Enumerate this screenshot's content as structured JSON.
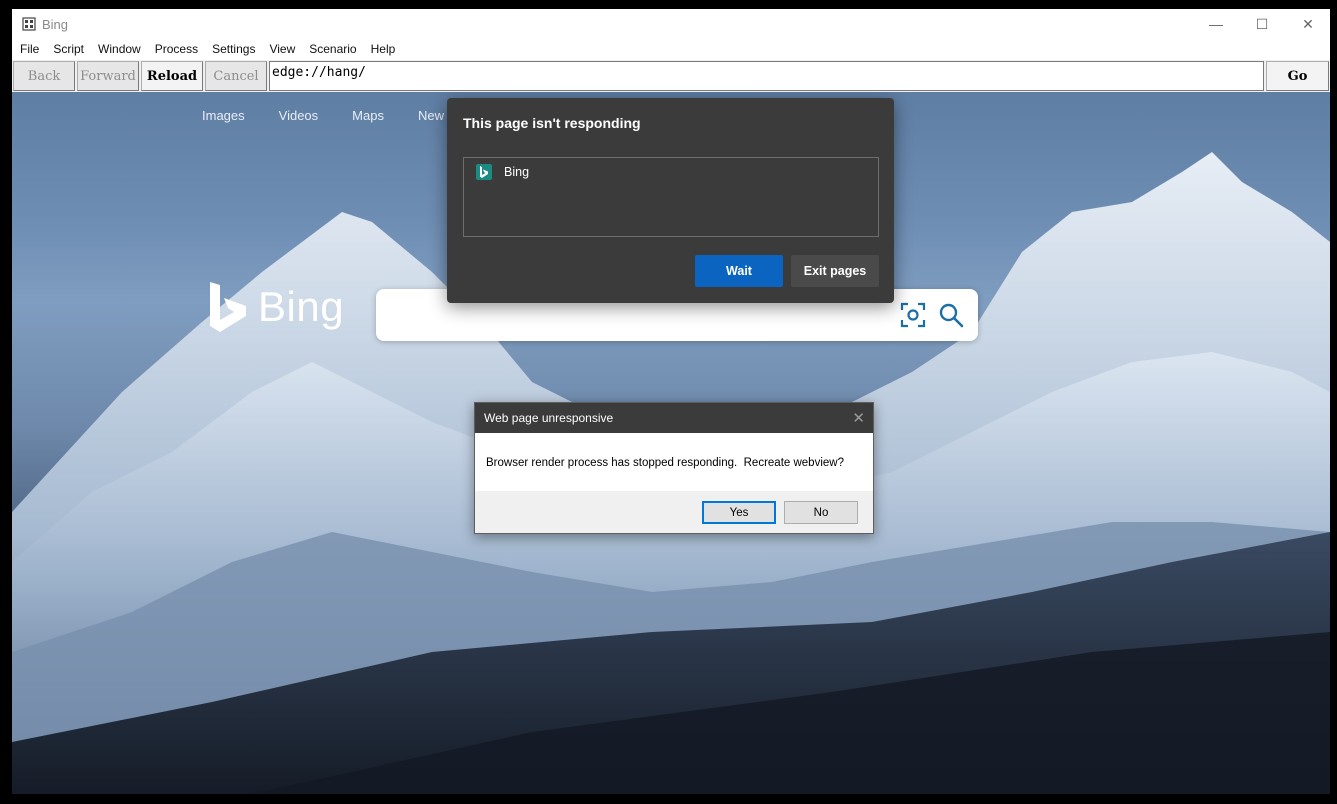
{
  "window": {
    "title": "Bing",
    "controls": {
      "minimize": "—",
      "maximize": "☐",
      "close": "✕"
    }
  },
  "menu": [
    "File",
    "Script",
    "Window",
    "Process",
    "Settings",
    "View",
    "Scenario",
    "Help"
  ],
  "toolbar": {
    "back_label": "Back",
    "forward_label": "Forward",
    "reload_label": "Reload",
    "cancel_label": "Cancel",
    "address_value": "edge://hang/",
    "go_label": "Go"
  },
  "bing": {
    "nav": [
      "Images",
      "Videos",
      "Maps",
      "New"
    ],
    "logo_text": "Bing"
  },
  "hang_dialog": {
    "title": "This page isn't responding",
    "pages": [
      {
        "label": "Bing",
        "icon": "bing-favicon-icon"
      }
    ],
    "wait_label": "Wait",
    "exit_label": "Exit pages"
  },
  "message_box": {
    "title": "Web page unresponsive",
    "text": "Browser render process has stopped responding.  Recreate webview?",
    "close_glyph": "✕",
    "yes_label": "Yes",
    "no_label": "No"
  },
  "colors": {
    "dialog_bg": "#3b3b3b",
    "primary_button": "#0a64c0",
    "bing_teal": "#1b8a82"
  }
}
